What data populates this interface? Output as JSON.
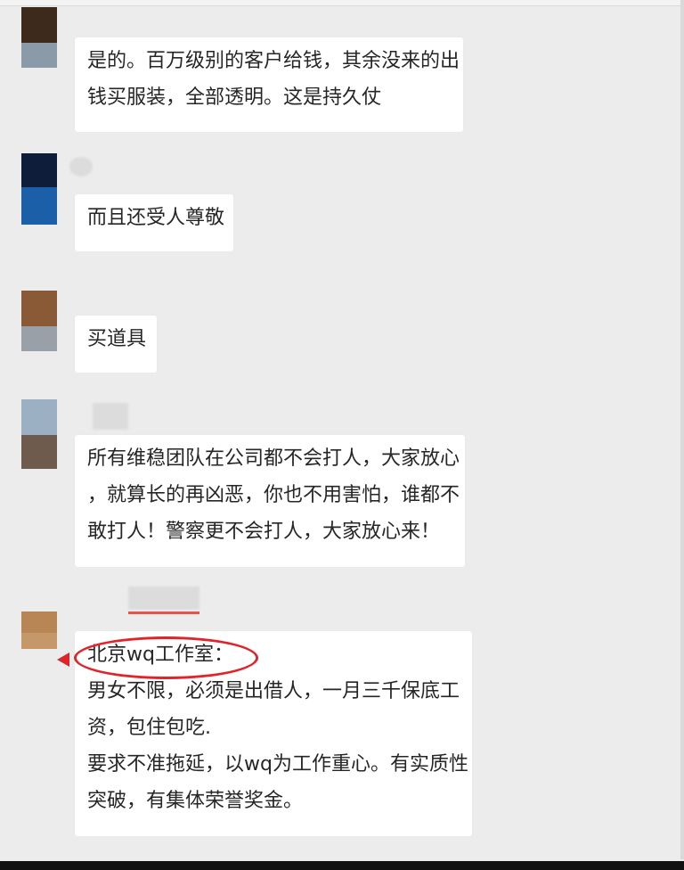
{
  "messages": [
    {
      "lines": [
        "是的。百万级别的客户给钱，其余没来的出",
        "钱买服装，全部透明。这是持久仗"
      ],
      "avatar_colors": [
        "#3e2a1c",
        "#8b9aa8"
      ]
    },
    {
      "lines": [
        "而且还受人尊敬"
      ],
      "avatar_colors": [
        "#0d1d3a",
        "#1b5fa8"
      ]
    },
    {
      "lines": [
        "买道具"
      ],
      "avatar_colors": [
        "#8a5a36",
        "#9aa0a8"
      ]
    },
    {
      "lines": [
        "所有维稳团队在公司都不会打人，大家放心",
        "，就算长的再凶恶，你也不用害怕，谁都不",
        "敢打人！警察更不会打人，大家放心来！"
      ],
      "avatar_colors": [
        "#9cb0c4",
        "#6f5a4e"
      ]
    },
    {
      "lines": [
        "北京wq工作室：",
        "男女不限，必须是出借人，一月三千保底工",
        "资，包住包吃.",
        "要求不准拖延，以wq为工作重心。有实质性",
        "突破，有集体荣誉奖金。"
      ],
      "avatar_colors": [
        "#b88655",
        "#c49868"
      ]
    }
  ],
  "colors": {
    "highlight": "#e0242a",
    "bubble": "#ffffff",
    "background": "#ececec"
  }
}
